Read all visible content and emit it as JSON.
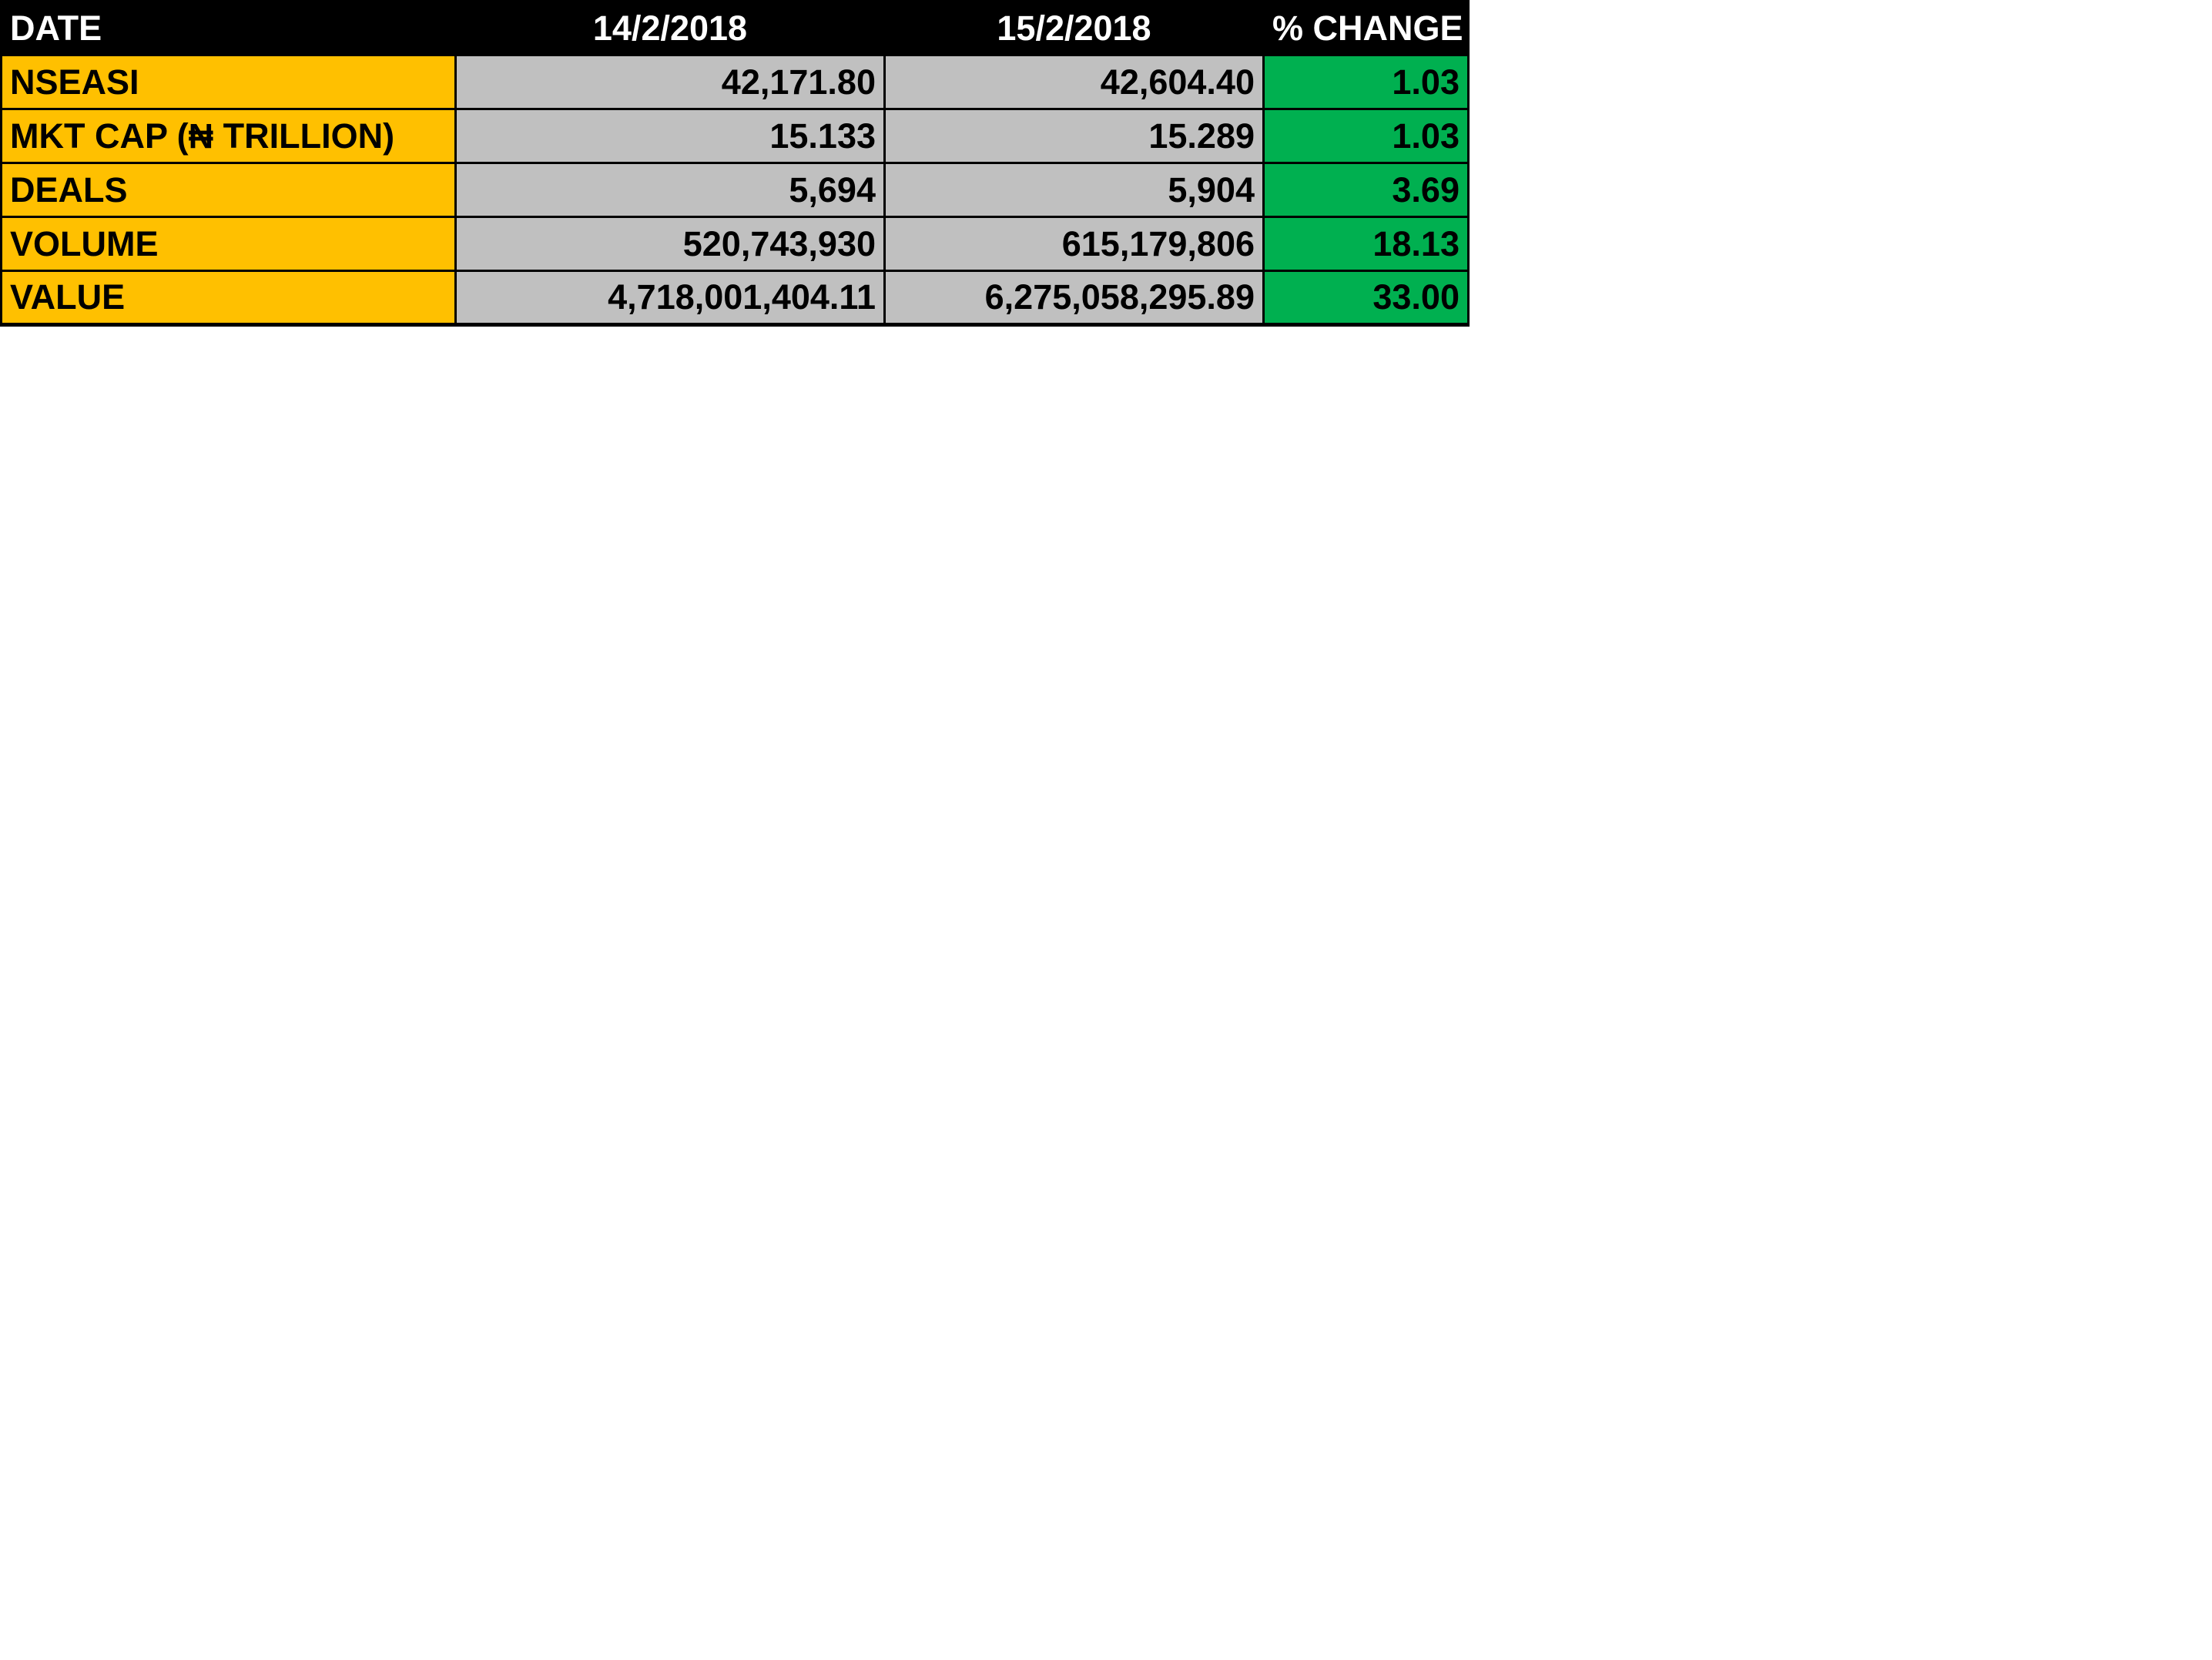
{
  "table": {
    "headers": [
      "DATE",
      "14/2/2018",
      "15/2/2018",
      "% CHANGE"
    ],
    "rows": [
      {
        "label": "NSEASI",
        "d1": "42,171.80",
        "d2": "42,604.40",
        "change": "1.03"
      },
      {
        "label": "MKT CAP (₦ TRILLION)",
        "d1": "15.133",
        "d2": "15.289",
        "change": "1.03"
      },
      {
        "label": "DEALS",
        "d1": "5,694",
        "d2": "5,904",
        "change": "3.69"
      },
      {
        "label": "VOLUME",
        "d1": "520,743,930",
        "d2": "615,179,806",
        "change": "18.13"
      },
      {
        "label": "VALUE",
        "d1": "4,718,001,404.11",
        "d2": "6,275,058,295.89",
        "change": "33.00"
      }
    ]
  },
  "colors": {
    "header_bg": "#000000",
    "label_bg": "#FFC000",
    "value_bg": "#C0C0C0",
    "change_bg": "#00B050"
  }
}
